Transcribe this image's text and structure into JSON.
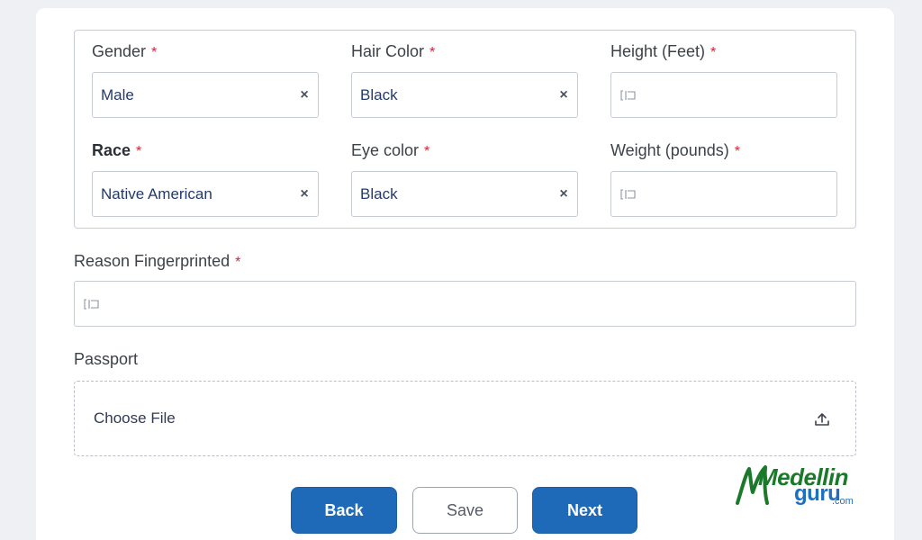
{
  "form": {
    "gender": {
      "label": "Gender",
      "value": "Male",
      "required": "*"
    },
    "hair_color": {
      "label": "Hair Color",
      "value": "Black",
      "required": "*"
    },
    "height": {
      "label": "Height (Feet)",
      "value": "",
      "required": "*"
    },
    "race": {
      "label": "Race",
      "value": "Native American",
      "required": "*"
    },
    "eye_color": {
      "label": "Eye color",
      "value": "Black",
      "required": "*"
    },
    "weight": {
      "label": "Weight (pounds)",
      "value": "",
      "required": "*"
    },
    "reason": {
      "label": "Reason Fingerprinted",
      "value": "",
      "required": "*"
    },
    "passport": {
      "label": "Passport",
      "choose_file": "Choose File"
    }
  },
  "buttons": {
    "back": "Back",
    "save": "Save",
    "next": "Next"
  },
  "clear_glyph": "×",
  "logo": {
    "part1": "Medellin",
    "part2": "guru",
    "part3": ".com"
  },
  "colors": {
    "primary": "#1f6ab8",
    "required": "#d0263a",
    "logo_green": "#1a7a2a",
    "logo_blue": "#1d6fc2"
  }
}
